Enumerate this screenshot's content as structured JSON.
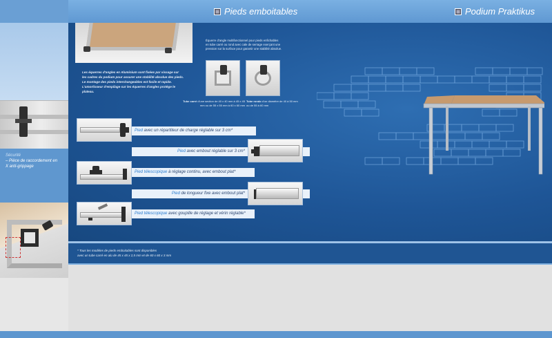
{
  "header": {
    "left_title": "Pieds emboitables",
    "right_title": "Podium Praktikus"
  },
  "sidebar": {
    "caption_title": "Sécurité",
    "caption_line1": "– Pièce de raccordement en",
    "caption_line2": "X anti-grippage"
  },
  "top_description": {
    "lines": [
      "Les équerres d'angles en Aluminium sont fixées par vissage sur",
      "les cadres du podium pour assurer une stabilité absolue des pieds.",
      "Le montage des pieds interchangeables est facile et rapide.",
      "L'amortisseur d'empilage sur les équerres d'angles protège le",
      "plateau."
    ]
  },
  "corner_description": {
    "lines": [
      "Équerre d'angle multifonctionnel pour pieds enfichables",
      "en tube carré ou rond avec cale de serrage exerçant une",
      "pression sur la surface pour garantir une stabilité absolue."
    ]
  },
  "thumb_captions": {
    "a_bold": "Tube carré",
    "a_line1": " d'une section de 40 x 40 mm à 45 x 45",
    "a_line2": "mm ou de 55 x 55 mm à 60 x 60 mm",
    "b_bold": "Tube rondo",
    "b_line1": " d'un diamètre de 40 à 50 mm",
    "b_line2": "ou de 55 à 60 mm"
  },
  "legs": {
    "row1_a": "Pied",
    "row1_b": " avec un répartiteur de charge réglable sur 3 cm*",
    "row2_a": "Pied",
    "row2_b": " avec embout réglable sur 3 cm*",
    "row3_a": "Pied télescopique",
    "row3_b": " à réglage continu, avec embout plat*",
    "row4_a": "Pied",
    "row4_b": " de longueur fixe avec embout plat*",
    "row5_a": "Pied télescopique",
    "row5_b": " avec goupille de réglage et vérin réglable*"
  },
  "footnote": {
    "line1": "* Tous les modèles de pieds emboitables sont disponibles",
    "line2": "avec un tube carré en alu de 45 x 45 x 2,5 mm et de 60 x 60 x 3 mm"
  }
}
